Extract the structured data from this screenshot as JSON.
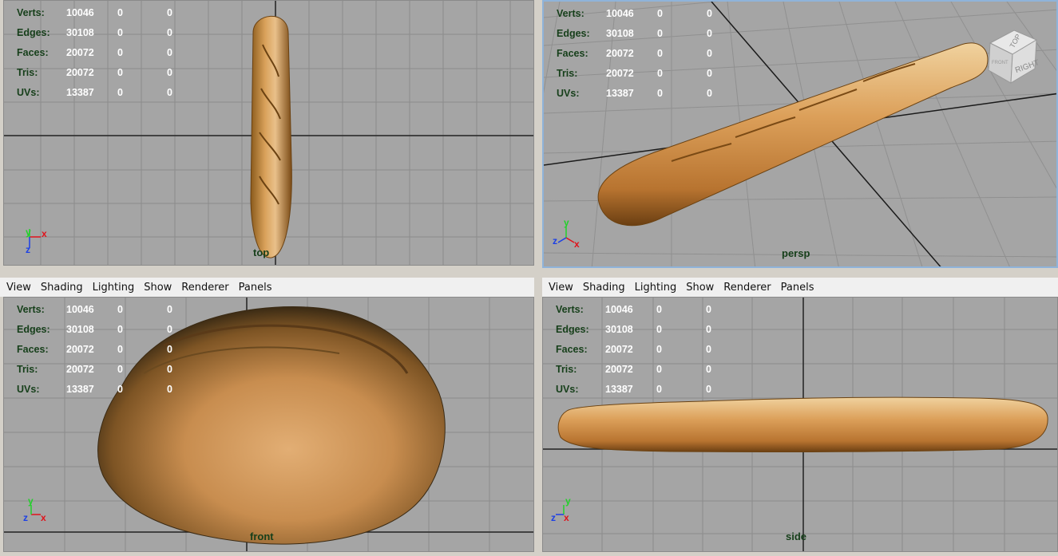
{
  "menu": [
    "View",
    "Shading",
    "Lighting",
    "Show",
    "Renderer",
    "Panels"
  ],
  "hud_rows": [
    {
      "label": "Verts:",
      "total": "10046",
      "a": "0",
      "b": "0"
    },
    {
      "label": "Edges:",
      "total": "30108",
      "a": "0",
      "b": "0"
    },
    {
      "label": "Faces:",
      "total": "20072",
      "a": "0",
      "b": "0"
    },
    {
      "label": "Tris:",
      "total": "20072",
      "a": "0",
      "b": "0"
    },
    {
      "label": "UVs:",
      "total": "13387",
      "a": "0",
      "b": "0"
    }
  ],
  "viewports": {
    "top": {
      "camera": "top"
    },
    "persp": {
      "camera": "persp"
    },
    "front": {
      "camera": "front"
    },
    "side": {
      "camera": "side"
    }
  },
  "viewcube": {
    "top": "TOP",
    "right": "RIGHT",
    "front": "FRONT"
  },
  "axes": {
    "x": "x",
    "y": "y",
    "z": "z"
  },
  "colors": {
    "x_axis": "#e0121b",
    "y_axis": "#22d02a",
    "z_axis": "#1b3fe6",
    "hud_label": "#163f1a",
    "viewport_bg": "#a5a5a5",
    "active_border": "#8fb3d9"
  }
}
